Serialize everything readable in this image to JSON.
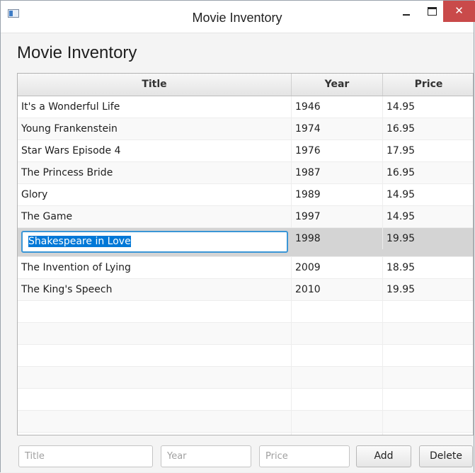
{
  "window": {
    "title": "Movie Inventory"
  },
  "heading": "Movie Inventory",
  "table": {
    "columns": [
      "Title",
      "Year",
      "Price"
    ],
    "rows": [
      {
        "title": "It's a Wonderful Life",
        "year": "1946",
        "price": "14.95"
      },
      {
        "title": "Young Frankenstein",
        "year": "1974",
        "price": "16.95"
      },
      {
        "title": "Star Wars Episode 4",
        "year": "1976",
        "price": "17.95"
      },
      {
        "title": "The Princess Bride",
        "year": "1987",
        "price": "16.95"
      },
      {
        "title": "Glory",
        "year": "1989",
        "price": "14.95"
      },
      {
        "title": "The Game",
        "year": "1997",
        "price": "14.95"
      },
      {
        "title": "Shakespeare in Love",
        "year": "1998",
        "price": "19.95"
      },
      {
        "title": "The Invention of Lying",
        "year": "2009",
        "price": "18.95"
      },
      {
        "title": "The King's Speech",
        "year": "2010",
        "price": "19.95"
      }
    ]
  },
  "form": {
    "title_placeholder": "Title",
    "year_placeholder": "Year",
    "price_placeholder": "Price",
    "add_label": "Add",
    "delete_label": "Delete"
  },
  "colors": {
    "selection": "#0078d7",
    "focus_border": "#3a96d6",
    "close_button": "#c94a4a"
  }
}
